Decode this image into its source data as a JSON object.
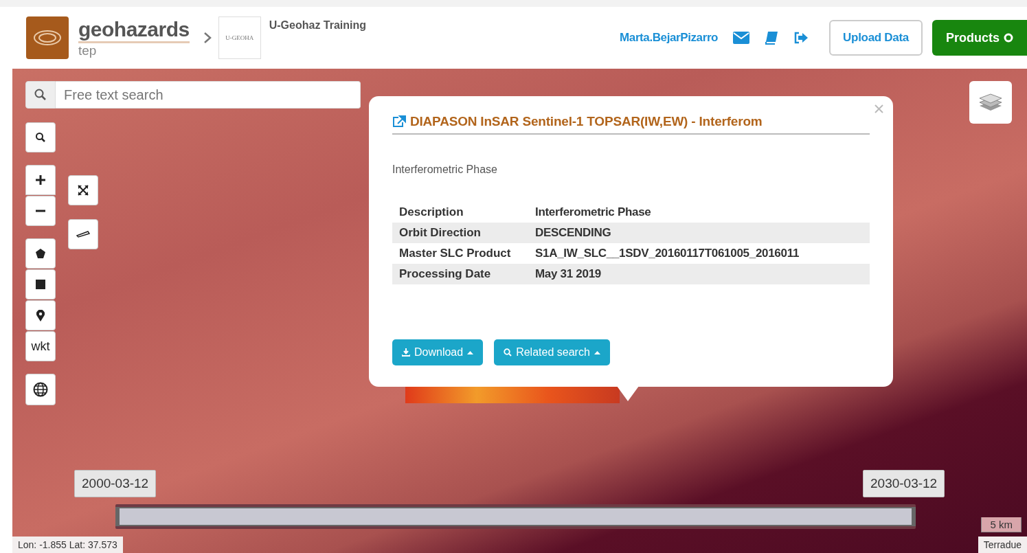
{
  "header": {
    "logo_title": "geohazards",
    "logo_subtitle": "tep",
    "community_logo": "U-GEOHA",
    "community": "U-Geohaz Training",
    "user": "Marta.BejarPizarro",
    "upload_button": "Upload Data",
    "products_button": "Products"
  },
  "map": {
    "search": {
      "placeholder": "Free text search"
    },
    "tools": [
      {
        "kind": "search"
      },
      {
        "kind": "zoom-in"
      },
      {
        "kind": "zoom-out"
      },
      {
        "kind": "polygon"
      },
      {
        "kind": "rectangle"
      },
      {
        "kind": "point"
      },
      {
        "kind": "wkt",
        "label": "wkt"
      },
      {
        "kind": "globe"
      }
    ],
    "side_tools": [
      {
        "kind": "fullscreen"
      },
      {
        "kind": "ruler"
      }
    ]
  },
  "popup": {
    "title": "DIAPASON InSAR Sentinel-1 TOPSAR(IW,EW) - Interferom",
    "subtitle": "Interferometric Phase",
    "rows": [
      {
        "label": "Description",
        "value": "Interferometric Phase"
      },
      {
        "label": "Orbit Direction",
        "value": "DESCENDING"
      },
      {
        "label": "Master SLC Product",
        "value": "S1A_IW_SLC__1SDV_20160117T061005_2016011"
      },
      {
        "label": "Processing Date",
        "value": "May 31 2019"
      }
    ],
    "buttons": [
      {
        "kind": "download",
        "label": "Download"
      },
      {
        "kind": "search",
        "label": "Related search"
      }
    ]
  },
  "timeline": {
    "start": "2000-03-12",
    "end": "2030-03-12",
    "level": 1
  },
  "coordinates": "Lon: -1.855 Lat: 37.573",
  "scale": "5 km",
  "attribution": "Terradue"
}
